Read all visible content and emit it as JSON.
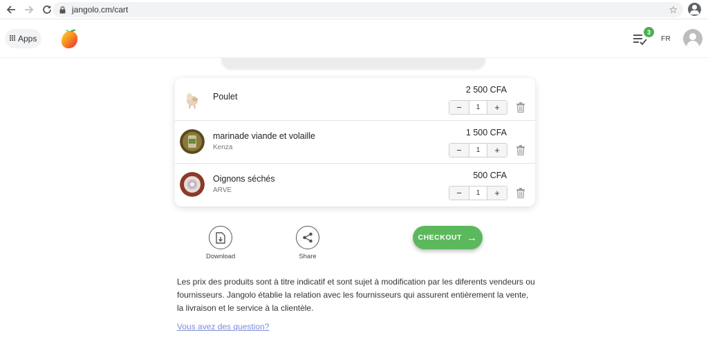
{
  "browser": {
    "url": "jangolo.cm/cart"
  },
  "header": {
    "apps_label": "Apps",
    "list_badge_count": "3",
    "language": "FR"
  },
  "cart": {
    "items": [
      {
        "name": "Poulet",
        "vendor": "",
        "price": "2 500 CFA",
        "quantity": "1",
        "minus": "−",
        "plus": "+"
      },
      {
        "name": "marinade viande et volaille",
        "vendor": "Kenza",
        "price": "1 500 CFA",
        "quantity": "1",
        "minus": "−",
        "plus": "+"
      },
      {
        "name": "Oignons séchés",
        "vendor": "ARVE",
        "price": "500 CFA",
        "quantity": "1",
        "minus": "−",
        "plus": "+"
      }
    ]
  },
  "actions": {
    "download_label": "Download",
    "share_label": "Share",
    "checkout_label": "CHECKOUT",
    "checkout_arrow": "→"
  },
  "footer": {
    "disclaimer": "Les prix des produits sont à titre indicatif et sont sujet à modification par les diferents vendeurs ou fournisseurs. Jangolo établie la relation avec les fournisseurs qui assurent entièrement la vente, la livraison et le service à la clientèle.",
    "question_link": "Vous avez des question?"
  },
  "colors": {
    "accent_green": "#5cb85c",
    "badge_green": "#4caf50",
    "link": "#7b8bd9"
  }
}
